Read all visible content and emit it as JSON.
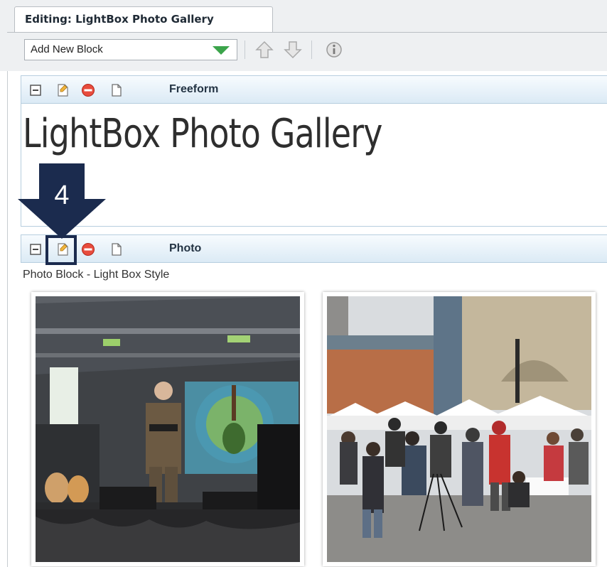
{
  "tab": {
    "label": "Editing: LightBox Photo Gallery"
  },
  "toolbar": {
    "add_block": {
      "value": "Add New Block"
    },
    "icons": [
      "move-up-arrow-icon",
      "move-down-arrow-icon",
      "info-icon"
    ]
  },
  "blocks": [
    {
      "label": "Freeform",
      "content_title": "LightBox Photo Gallery"
    },
    {
      "label": "Photo",
      "description": "Photo Block - Light Box Style"
    }
  ],
  "callout": {
    "number": "4"
  },
  "colors": {
    "callout": "#1b2b4e",
    "block_bar": "#dbeaf5",
    "dropdown_arrow": "#3ba44b",
    "delete": "#e84c3d"
  }
}
